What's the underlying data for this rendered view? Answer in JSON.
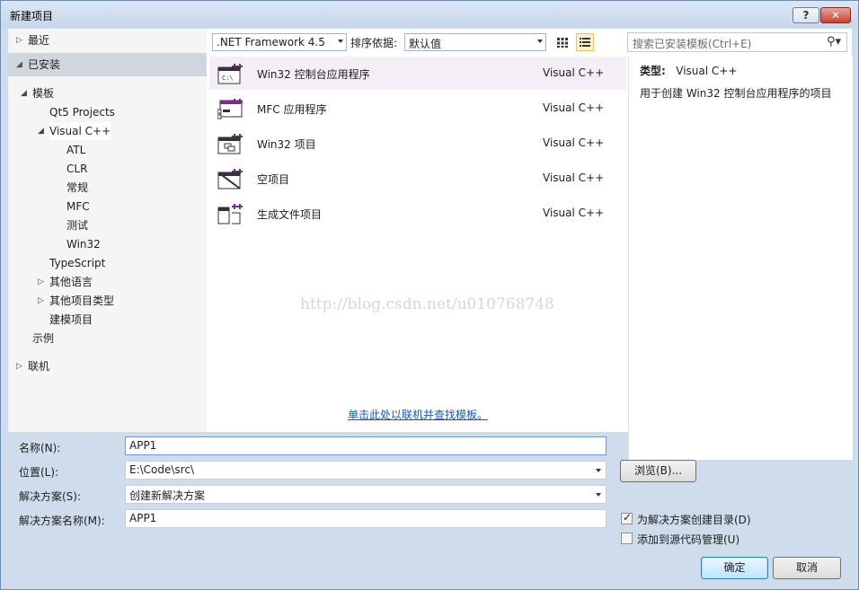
{
  "window": {
    "title": "新建项目",
    "help": "?",
    "close": "✕"
  },
  "nav": {
    "recent": "最近",
    "installed": "已安装",
    "online": "联机",
    "tree": [
      {
        "label": "模板",
        "level": 0,
        "arrow": "◢"
      },
      {
        "label": "Qt5 Projects",
        "level": 1,
        "arrow": ""
      },
      {
        "label": "Visual C++",
        "level": 1,
        "arrow": "◢"
      },
      {
        "label": "ATL",
        "level": 2,
        "arrow": ""
      },
      {
        "label": "CLR",
        "level": 2,
        "arrow": ""
      },
      {
        "label": "常规",
        "level": 2,
        "arrow": ""
      },
      {
        "label": "MFC",
        "level": 2,
        "arrow": ""
      },
      {
        "label": "测试",
        "level": 2,
        "arrow": ""
      },
      {
        "label": "Win32",
        "level": 2,
        "arrow": ""
      },
      {
        "label": "TypeScript",
        "level": 1,
        "arrow": ""
      },
      {
        "label": "其他语言",
        "level": 1,
        "arrow": "▷"
      },
      {
        "label": "其他项目类型",
        "level": 1,
        "arrow": "▷"
      },
      {
        "label": "建模项目",
        "level": 1,
        "arrow": ""
      },
      {
        "label": "示例",
        "level": 0,
        "arrow": ""
      }
    ]
  },
  "toolbar": {
    "framework": ".NET Framework 4.5",
    "sort_label": "排序依据:",
    "sort_value": "默认值",
    "search_placeholder": "搜索已安装模板(Ctrl+E)"
  },
  "templates": [
    {
      "name": "Win32 控制台应用程序",
      "lang": "Visual C++",
      "icon": "console-app-icon"
    },
    {
      "name": "MFC 应用程序",
      "lang": "Visual C++",
      "icon": "mfc-app-icon"
    },
    {
      "name": "Win32 项目",
      "lang": "Visual C++",
      "icon": "win32-project-icon"
    },
    {
      "name": "空项目",
      "lang": "Visual C++",
      "icon": "empty-project-icon"
    },
    {
      "name": "生成文件项目",
      "lang": "Visual C++",
      "icon": "makefile-project-icon"
    }
  ],
  "online_link": "单击此处以联机并查找模板。",
  "watermark": "http://blog.csdn.net/u010768748",
  "details": {
    "type_label": "类型:",
    "type_value": "Visual C++",
    "description": "用于创建 Win32 控制台应用程序的项目"
  },
  "form": {
    "name_label": "名称(N):",
    "name_value": "APP1",
    "location_label": "位置(L):",
    "location_value": "E:\\Code\\src\\",
    "solution_label": "解决方案(S):",
    "solution_value": "创建新解决方案",
    "solution_name_label": "解决方案名称(M):",
    "solution_name_value": "APP1",
    "browse": "浏览(B)...",
    "create_dir": "为解决方案创建目录(D)",
    "create_dir_checked": true,
    "add_scc": "添加到源代码管理(U)",
    "add_scc_checked": false,
    "ok": "确定",
    "cancel": "取消"
  }
}
